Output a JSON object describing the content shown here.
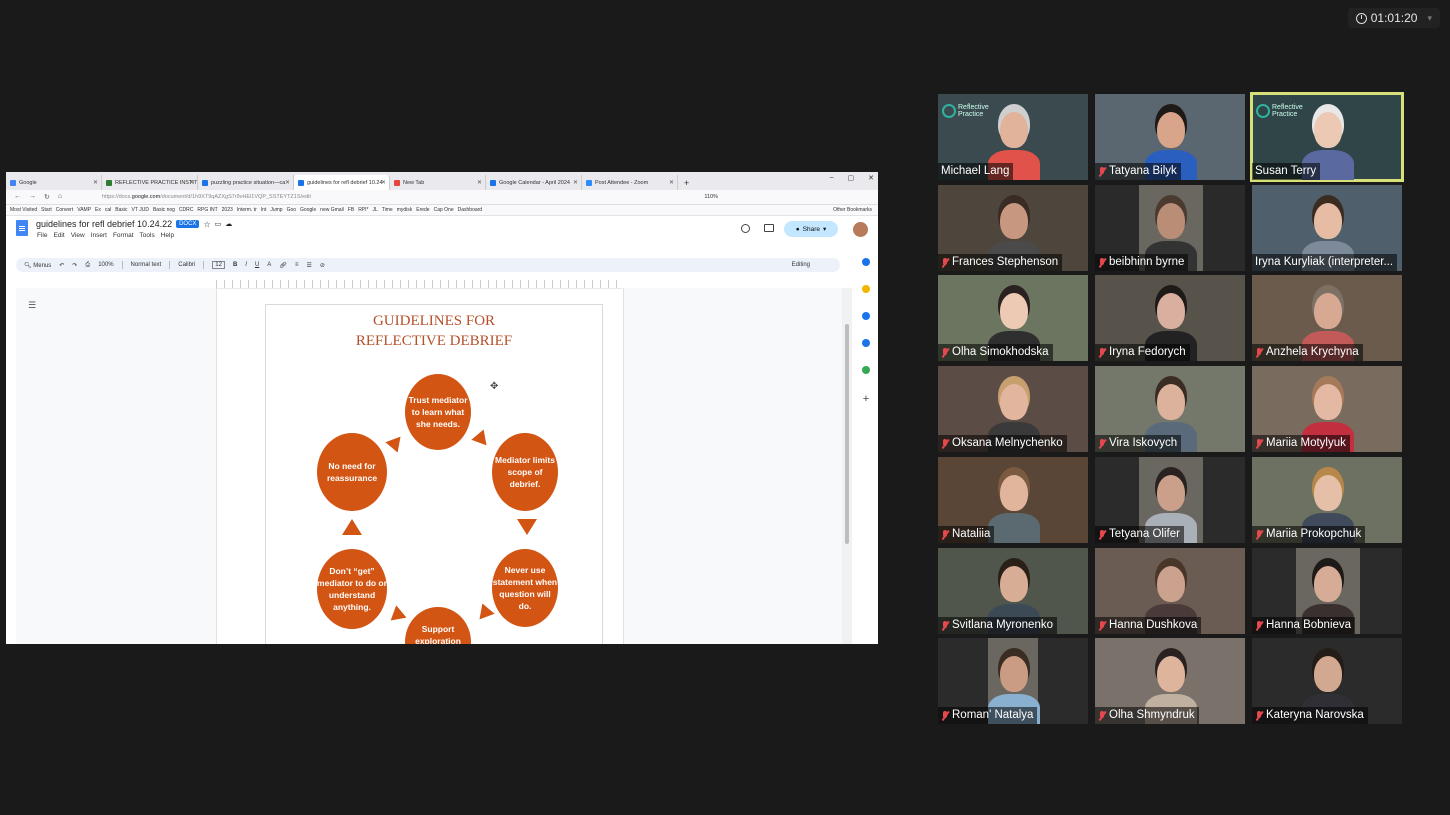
{
  "meeting": {
    "elapsed_time": "01:01:20",
    "icons": {
      "timer": "clock-icon",
      "more": "chevron-down-icon",
      "muted": "mic-muted-icon"
    },
    "colors": {
      "background": "#1a1a1a",
      "speaker_border": "#d8e07a",
      "muted_mic": "#e5484d"
    }
  },
  "browser": {
    "tabs": [
      {
        "label": "Google",
        "color": "#4285f4"
      },
      {
        "label": "REFLECTIVE PRACTICE INSTITUTE",
        "color": "#2e7d32"
      },
      {
        "label": "puzzling practice situation—ca",
        "color": "#1a73e8"
      },
      {
        "label": "guidelines for refl debrief 10.24",
        "color": "#1a73e8"
      },
      {
        "label": "New Tab",
        "color": "#e8453c"
      },
      {
        "label": "Google Calendar - April 2024",
        "color": "#1a73e8"
      },
      {
        "label": "Post Attendee - Zoom",
        "color": "#2d8cff"
      }
    ],
    "url_prefix": "https://docs.",
    "url_domain": "google.com",
    "url_rest": "/document/d/1h9XT9qAZXgS7r9vHEl1VQP_SSTEYTZ1S/edit",
    "zoom": "110%",
    "bookmarks": [
      "Most Visited",
      "Start",
      "Convert",
      "VAMP",
      "Ex",
      "cal",
      "Basic",
      "VT JUD",
      "Basic nog",
      "CDRC",
      "RPG INT",
      "2023",
      "Interm. tr",
      "Int",
      "Jump",
      "Goo",
      "Google",
      "new Gmail",
      "FB",
      "RPI*",
      "JL",
      "Time",
      "mydisk",
      "Erede",
      "Cap One",
      "Dashboard"
    ],
    "other_bookmarks": "Other Bookmarks"
  },
  "docs": {
    "title": "guidelines for refl debrief 10.24.22",
    "file_type": "DOCX",
    "menu": [
      "File",
      "Edit",
      "View",
      "Insert",
      "Format",
      "Tools",
      "Help"
    ],
    "share_label": "Share",
    "toolbar": {
      "search": "Menus",
      "zoom": "100%",
      "style": "Normal text",
      "font": "Calibri",
      "font_size": "12",
      "mode": "Editing"
    },
    "heading_line1": "GUIDELINES FOR",
    "heading_line2": "REFLECTIVE DEBRIEF",
    "cycle": [
      "Trust mediator to learn what she needs.",
      "Mediator limits scope of debrief.",
      "Never use statement when question will do.",
      "Support exploration",
      "Don’t “get” mediator to do or understand anything.",
      "No need for reassurance"
    ],
    "cycle_color": "#d35514"
  },
  "participants": [
    {
      "name": "Michael Lang",
      "muted": false,
      "logo": true,
      "speaking": false
    },
    {
      "name": "Tatyana Bilyk",
      "muted": true,
      "speaking": false
    },
    {
      "name": "Susan Terry",
      "muted": false,
      "logo": true,
      "speaking": true
    },
    {
      "name": "Frances Stephenson",
      "muted": true,
      "speaking": false
    },
    {
      "name": "beibhinn byrne",
      "muted": true,
      "speaking": false
    },
    {
      "name": "Iryna Kuryliak (interpreter...",
      "muted": false,
      "speaking": false
    },
    {
      "name": "Olha Simokhodska",
      "muted": true,
      "speaking": false
    },
    {
      "name": "Iryna Fedorych",
      "muted": true,
      "speaking": false
    },
    {
      "name": "Anzhela Krychyna",
      "muted": true,
      "speaking": false
    },
    {
      "name": "Oksana Melnychenko",
      "muted": true,
      "speaking": false
    },
    {
      "name": "Vira Iskovych",
      "muted": true,
      "speaking": false
    },
    {
      "name": "Mariia Motylyuk",
      "muted": true,
      "speaking": false
    },
    {
      "name": "Nataliia",
      "muted": true,
      "speaking": false
    },
    {
      "name": "Tetyana Olifer",
      "muted": true,
      "speaking": false
    },
    {
      "name": "Mariia Prokopchuk",
      "muted": true,
      "speaking": false
    },
    {
      "name": "Svitlana Myronenko",
      "muted": true,
      "speaking": false
    },
    {
      "name": "Hanna Dushkova",
      "muted": true,
      "speaking": false
    },
    {
      "name": "Hanna Bobnieva",
      "muted": true,
      "speaking": false
    },
    {
      "name": "Roman' Natalya",
      "muted": true,
      "speaking": false
    },
    {
      "name": "Olha Shmyndruk",
      "muted": true,
      "speaking": false
    },
    {
      "name": "Kateryna Narovska",
      "muted": true,
      "speaking": false
    }
  ],
  "logo_text_1": "Reflective",
  "logo_text_2": "Practice"
}
